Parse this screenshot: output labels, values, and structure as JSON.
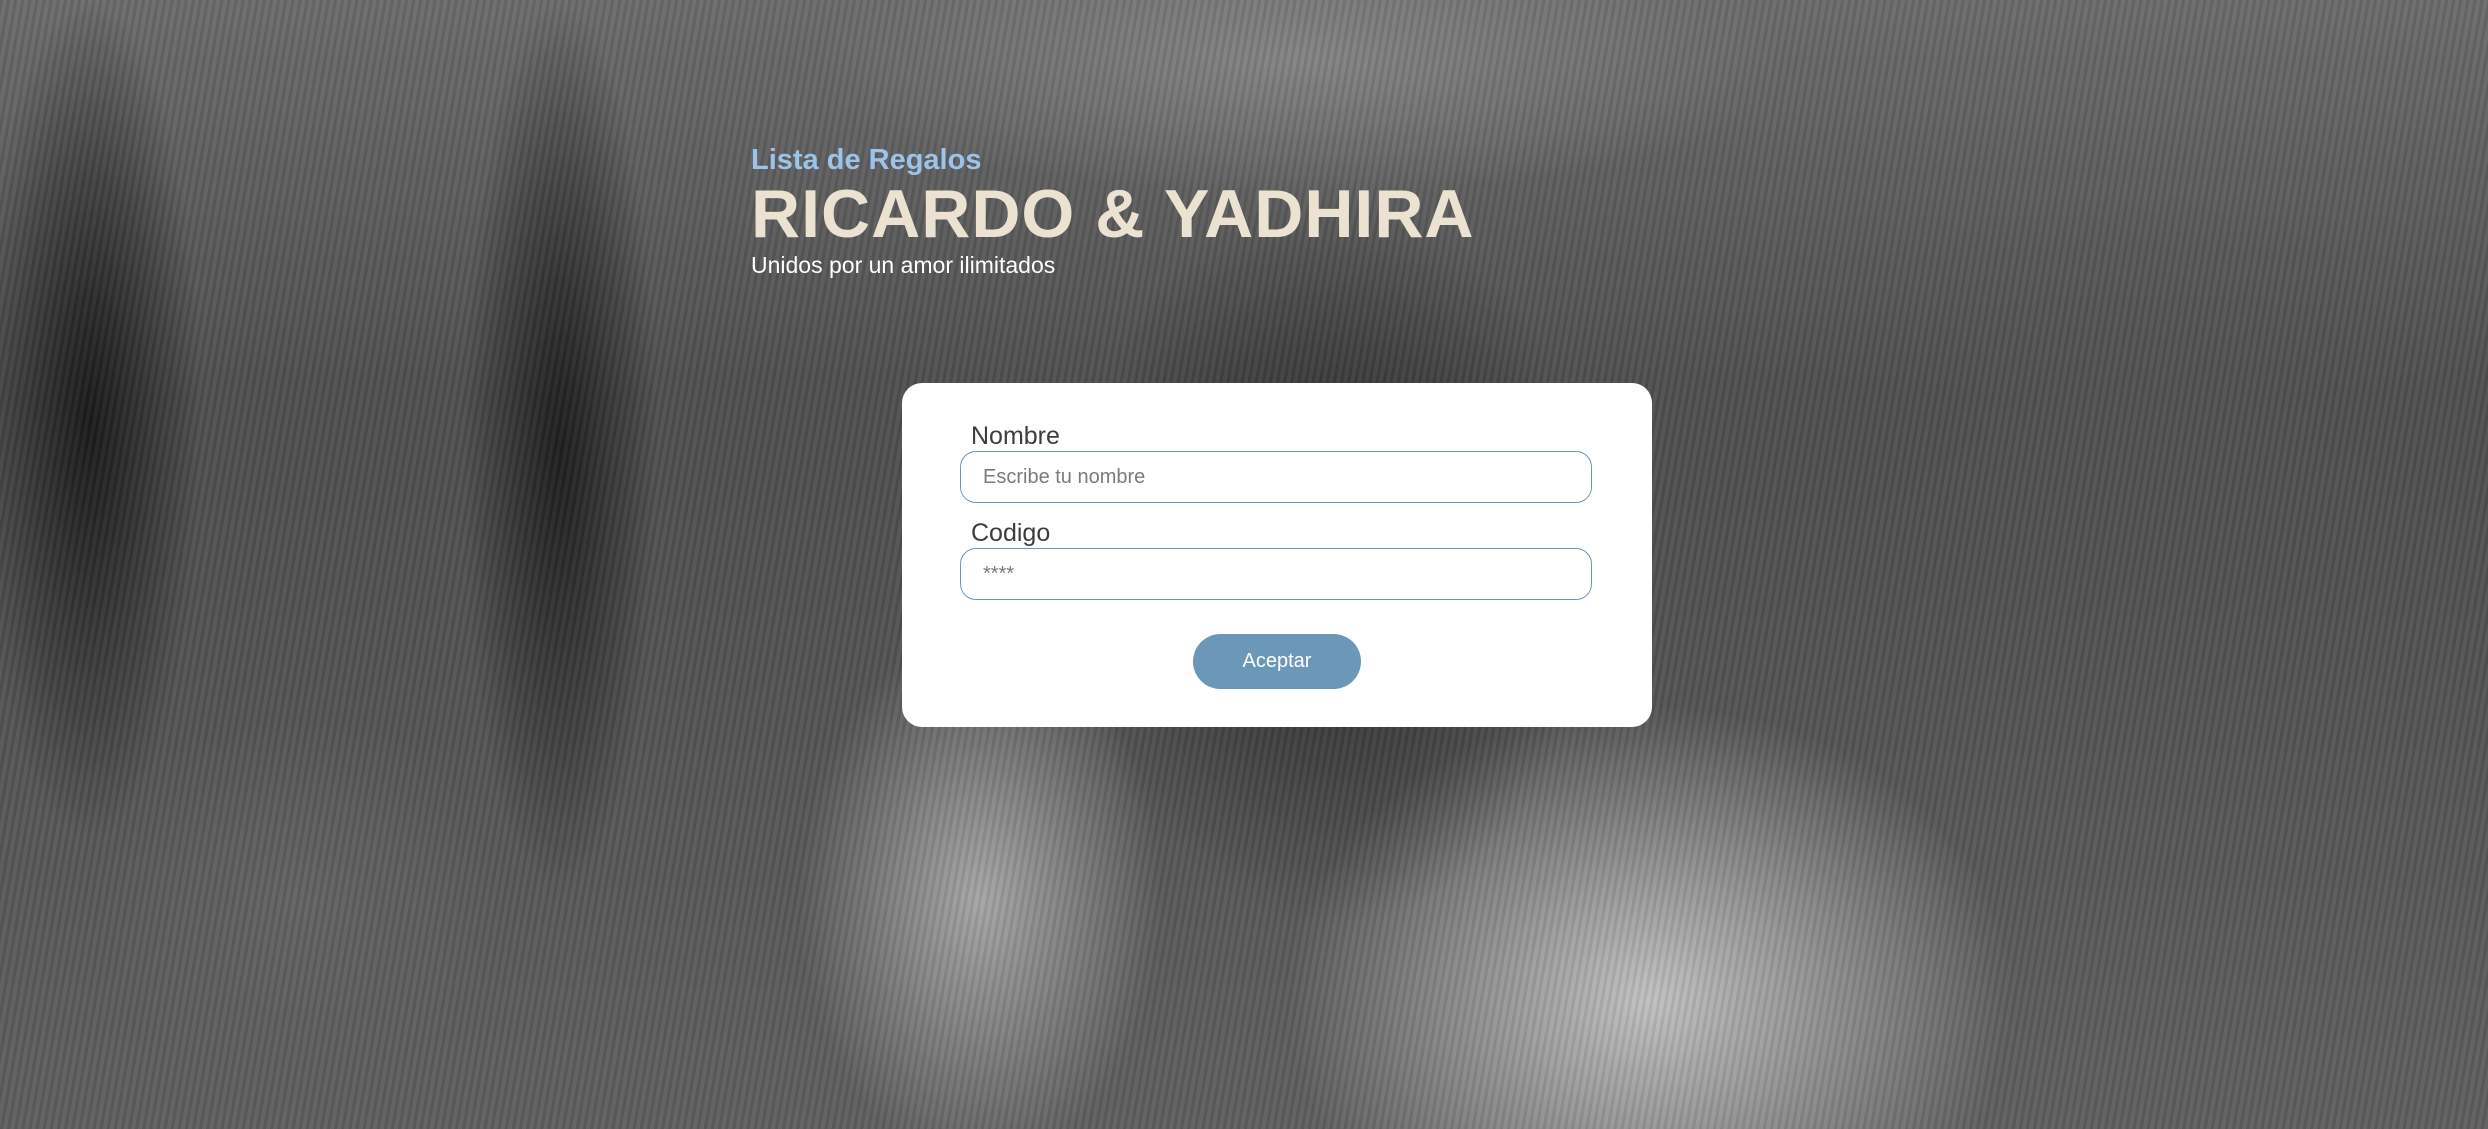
{
  "header": {
    "kicker": "Lista de Regalos",
    "names": "RICARDO & YADHIRA",
    "tagline": "Unidos por un amor ilimitados"
  },
  "form": {
    "name_label": "Nombre",
    "name_placeholder": "Escribe tu nombre",
    "code_label": "Codigo",
    "code_placeholder": "****",
    "submit_label": "Aceptar"
  },
  "colors": {
    "kicker": "#9cc3ea",
    "names": "#ece2d2",
    "button": "#6b97b9",
    "input_border": "#6f96b6"
  }
}
